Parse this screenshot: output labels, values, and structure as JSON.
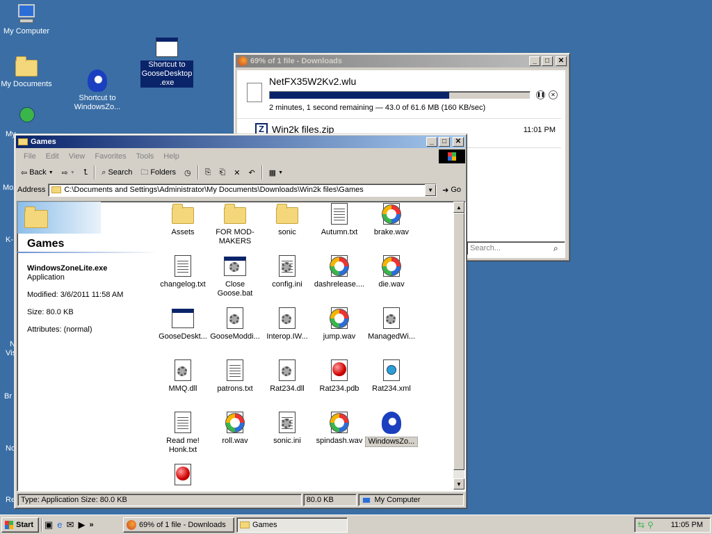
{
  "desktop": {
    "icons": [
      {
        "label": "My Computer"
      },
      {
        "label": "My Documents"
      },
      {
        "label": "Shortcut to WindowsZo..."
      },
      {
        "label": "Shortcut to GooseDesktop .exe"
      },
      {
        "label": "My"
      }
    ],
    "edge_labels": [
      "Moz",
      "K-",
      "N",
      "Vis",
      "Br",
      "No",
      "Re"
    ]
  },
  "downloads": {
    "title": "69% of 1 file - Downloads",
    "item1": {
      "name": "NetFX35W2Kv2.wlu",
      "status": "2 minutes, 1 second remaining — 43.0 of 61.6 MB (160 KB/sec)",
      "progress": 0.69
    },
    "item2": {
      "name": "Win2k files.zip",
      "time": "11:01 PM"
    },
    "search_placeholder": "Search..."
  },
  "explorer": {
    "title": "Games",
    "menu": [
      "File",
      "Edit",
      "View",
      "Favorites",
      "Tools",
      "Help"
    ],
    "toolbar": {
      "back": "Back",
      "search": "Search",
      "folders": "Folders"
    },
    "address_label": "Address",
    "address_value": "C:\\Documents and Settings\\Administrator\\My Documents\\Downloads\\Win2k files\\Games",
    "go_label": "Go",
    "side": {
      "folder_title": "Games",
      "file_name": "WindowsZoneLite.exe",
      "file_type": "Application",
      "modified": "Modified: 3/6/2011 11:58 AM",
      "size": "Size: 80.0 KB",
      "attributes": "Attributes: (normal)"
    },
    "files": [
      {
        "label": "Assets",
        "icon": "folder"
      },
      {
        "label": "FOR MOD-MAKERS",
        "icon": "folder"
      },
      {
        "label": "sonic",
        "icon": "folder"
      },
      {
        "label": "Autumn.txt",
        "icon": "text"
      },
      {
        "label": "brake.wav",
        "icon": "media"
      },
      {
        "label": "changelog.txt",
        "icon": "text"
      },
      {
        "label": "Close Goose.bat",
        "icon": "batch"
      },
      {
        "label": "config.ini",
        "icon": "ini"
      },
      {
        "label": "dashrelease....",
        "icon": "media"
      },
      {
        "label": "die.wav",
        "icon": "media"
      },
      {
        "label": "GooseDeskt...",
        "icon": "app"
      },
      {
        "label": "GooseModdi...",
        "icon": "dll"
      },
      {
        "label": "Interop.IW...",
        "icon": "dll"
      },
      {
        "label": "jump.wav",
        "icon": "media"
      },
      {
        "label": "ManagedWi...",
        "icon": "dll"
      },
      {
        "label": "MMQ.dll",
        "icon": "dll"
      },
      {
        "label": "patrons.txt",
        "icon": "text"
      },
      {
        "label": "Rat234.dll",
        "icon": "dll"
      },
      {
        "label": "Rat234.pdb",
        "icon": "pdb"
      },
      {
        "label": "Rat234.xml",
        "icon": "xml"
      },
      {
        "label": "Read me! Honk.txt",
        "icon": "text"
      },
      {
        "label": "roll.wav",
        "icon": "media"
      },
      {
        "label": "sonic.ini",
        "icon": "ini"
      },
      {
        "label": "spindash.wav",
        "icon": "media"
      },
      {
        "label": "WindowsZo...",
        "icon": "sonic"
      },
      {
        "label": "",
        "icon": "pdb"
      }
    ],
    "status": {
      "left": "Type: Application Size: 80.0 KB",
      "size": "80.0 KB",
      "zone": "My Computer"
    }
  },
  "taskbar": {
    "start": "Start",
    "tasks": [
      "69% of 1 file - Downloads",
      "Games"
    ],
    "clock": "11:05 PM"
  }
}
